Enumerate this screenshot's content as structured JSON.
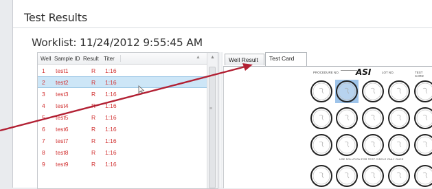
{
  "window": {
    "title": "Test Results"
  },
  "worklist": {
    "label": "Worklist: 11/24/2012 9:55:45 AM"
  },
  "grid": {
    "columns": [
      "Well",
      "Sample ID",
      "Result",
      "Titer"
    ],
    "rows": [
      {
        "well": "1",
        "sample_id": "test1",
        "result": "R",
        "titer": "1:16"
      },
      {
        "well": "2",
        "sample_id": "test2",
        "result": "R",
        "titer": "1:16"
      },
      {
        "well": "3",
        "sample_id": "test3",
        "result": "R",
        "titer": "1:16"
      },
      {
        "well": "4",
        "sample_id": "test4",
        "result": "R",
        "titer": "1:16"
      },
      {
        "well": "5",
        "sample_id": "test5",
        "result": "R",
        "titer": "1:16"
      },
      {
        "well": "6",
        "sample_id": "test6",
        "result": "R",
        "titer": "1:16"
      },
      {
        "well": "7",
        "sample_id": "test7",
        "result": "R",
        "titer": "1:16"
      },
      {
        "well": "8",
        "sample_id": "test8",
        "result": "R",
        "titer": "1:16"
      },
      {
        "well": "9",
        "sample_id": "test9",
        "result": "R",
        "titer": "1:16"
      }
    ],
    "selected_row": "2",
    "text_color": "#d13030",
    "selected_color": "#cde6f7"
  },
  "tabs": [
    {
      "label": "Well Result"
    },
    {
      "label": "Test Card",
      "active": true
    }
  ],
  "test_card": {
    "header_left": "PROCEDURE NO.",
    "logo": "ASI",
    "header_mid": "LOT NO.",
    "header_right": "TEST CARD",
    "caption": "USE SOLUTION FOR TEST CIRCLE ONLY ONCE",
    "highlighted_well": "2"
  },
  "annotation": {
    "arrow_color": "#b22033"
  }
}
